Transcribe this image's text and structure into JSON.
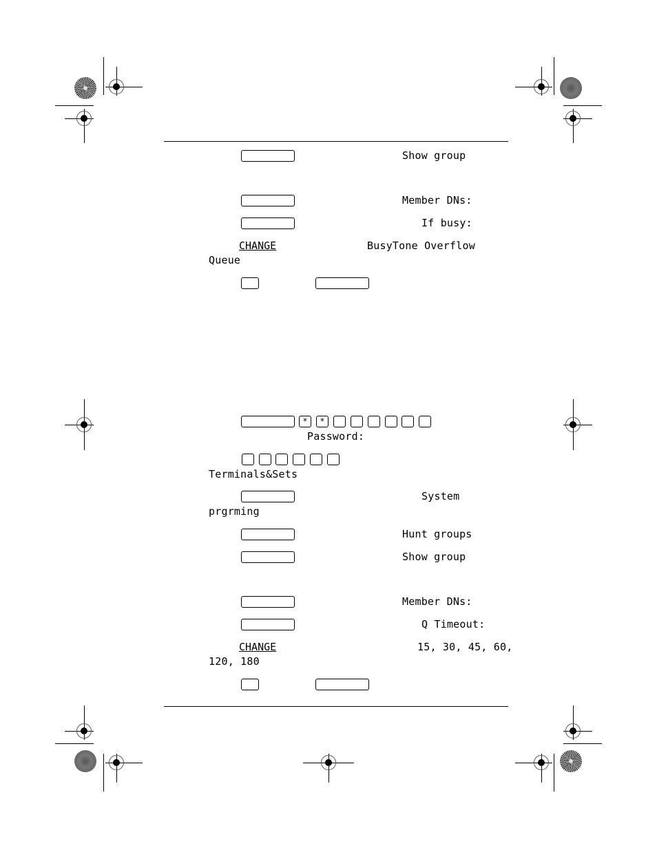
{
  "section1": {
    "step1": {
      "display": "Show group"
    },
    "step2": {
      "display": "Member DNs:"
    },
    "step3": {
      "display": "If busy:"
    },
    "step4": {
      "softkey": "CHANGE",
      "display_line1": "BusyTone Overflow",
      "display_line2": "Queue"
    }
  },
  "section2": {
    "step1": {
      "star_keys": [
        "*",
        "*"
      ],
      "display": "Password:"
    },
    "step2": {
      "display": "Terminals&Sets"
    },
    "step3": {
      "display_line1": "System",
      "display_line2": "prgrming"
    },
    "step4": {
      "display": "Hunt groups"
    },
    "step5": {
      "display": "Show group"
    },
    "step6": {
      "display": "Member DNs:"
    },
    "step7": {
      "display": "Q Timeout:"
    },
    "step8": {
      "softkey": "CHANGE",
      "display_line1": "15, 30, 45, 60,",
      "display_line2": "120, 180"
    }
  },
  "icons": {
    "registration_mark": "crosshair-target-icon",
    "star_target": "starburst-icon",
    "gray_disc": "halftone-disc-icon"
  }
}
